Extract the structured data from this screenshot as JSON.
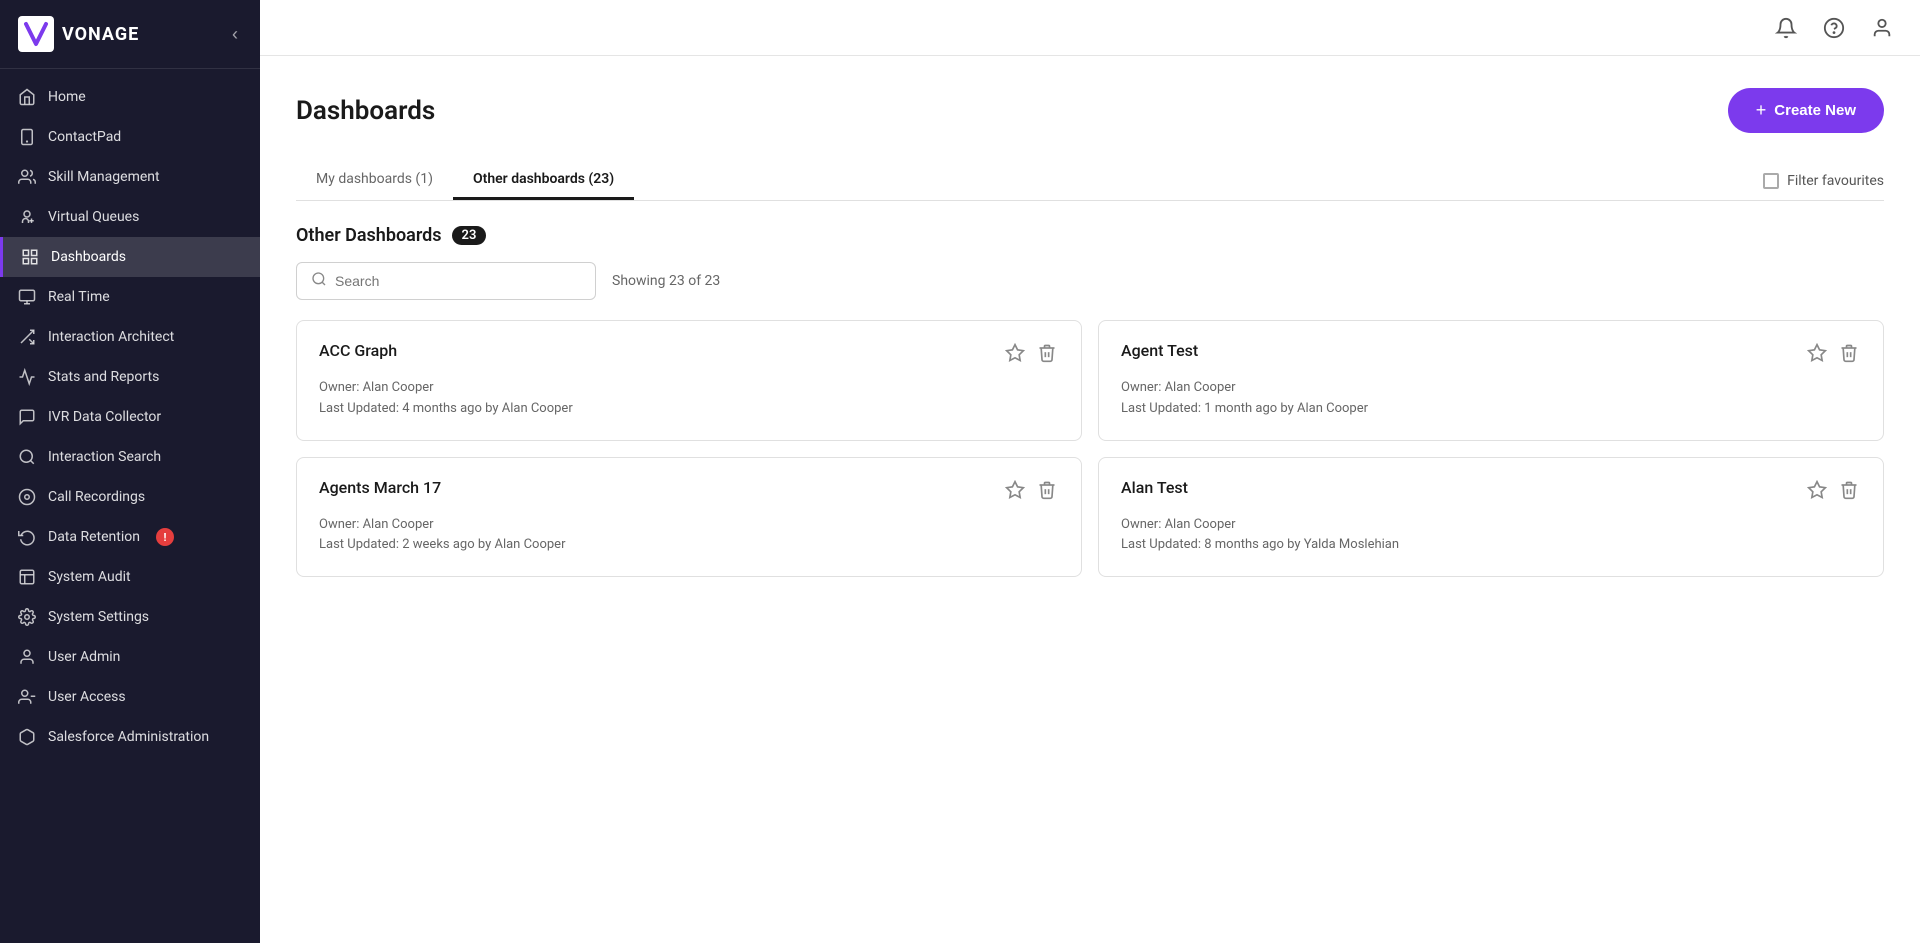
{
  "sidebar": {
    "logo_text": "VONAGE",
    "collapse_label": "Collapse",
    "nav_items": [
      {
        "id": "home",
        "label": "Home",
        "icon": "home"
      },
      {
        "id": "contactpad",
        "label": "ContactPad",
        "icon": "phone"
      },
      {
        "id": "skill-management",
        "label": "Skill Management",
        "icon": "people"
      },
      {
        "id": "virtual-queues",
        "label": "Virtual Queues",
        "icon": "queue"
      },
      {
        "id": "dashboards",
        "label": "Dashboards",
        "icon": "dashboard",
        "active": true
      },
      {
        "id": "real-time",
        "label": "Real Time",
        "icon": "realtime"
      },
      {
        "id": "interaction-architect",
        "label": "Interaction Architect",
        "icon": "architect"
      },
      {
        "id": "stats-reports",
        "label": "Stats and Reports",
        "icon": "stats"
      },
      {
        "id": "ivr-data-collector",
        "label": "IVR Data Collector",
        "icon": "ivr"
      },
      {
        "id": "interaction-search",
        "label": "Interaction Search",
        "icon": "search"
      },
      {
        "id": "call-recordings",
        "label": "Call Recordings",
        "icon": "recording"
      },
      {
        "id": "data-retention",
        "label": "Data Retention",
        "icon": "retention",
        "badge": "!"
      },
      {
        "id": "system-audit",
        "label": "System Audit",
        "icon": "audit"
      },
      {
        "id": "system-settings",
        "label": "System Settings",
        "icon": "settings"
      },
      {
        "id": "user-admin",
        "label": "User Admin",
        "icon": "user-admin"
      },
      {
        "id": "user-access",
        "label": "User Access",
        "icon": "user-access"
      },
      {
        "id": "salesforce-admin",
        "label": "Salesforce Administration",
        "icon": "salesforce"
      }
    ]
  },
  "topbar": {
    "notification_icon": "bell",
    "help_icon": "question",
    "user_icon": "user-circle"
  },
  "page": {
    "title": "Dashboards",
    "create_button_label": "Create New"
  },
  "tabs": [
    {
      "id": "my-dashboards",
      "label": "My dashboards (1)",
      "active": false
    },
    {
      "id": "other-dashboards",
      "label": "Other dashboards (23)",
      "active": true
    }
  ],
  "filter": {
    "label": "Filter favourites"
  },
  "section": {
    "title": "Other Dashboards",
    "count": "23"
  },
  "search": {
    "placeholder": "Search",
    "showing_text": "Showing 23 of 23"
  },
  "cards": [
    {
      "id": "acc-graph",
      "title": "ACC Graph",
      "owner": "Owner: Alan Cooper",
      "updated": "Last Updated: 4 months ago by Alan Cooper"
    },
    {
      "id": "agent-test",
      "title": "Agent Test",
      "owner": "Owner: Alan Cooper",
      "updated": "Last Updated: 1 month ago by Alan Cooper"
    },
    {
      "id": "agents-march-17",
      "title": "Agents March 17",
      "owner": "Owner: Alan Cooper",
      "updated": "Last Updated: 2 weeks ago by Alan Cooper"
    },
    {
      "id": "alan-test",
      "title": "Alan Test",
      "owner": "Owner: Alan Cooper",
      "updated": "Last Updated: 8 months ago by Yalda Moslehian"
    }
  ]
}
